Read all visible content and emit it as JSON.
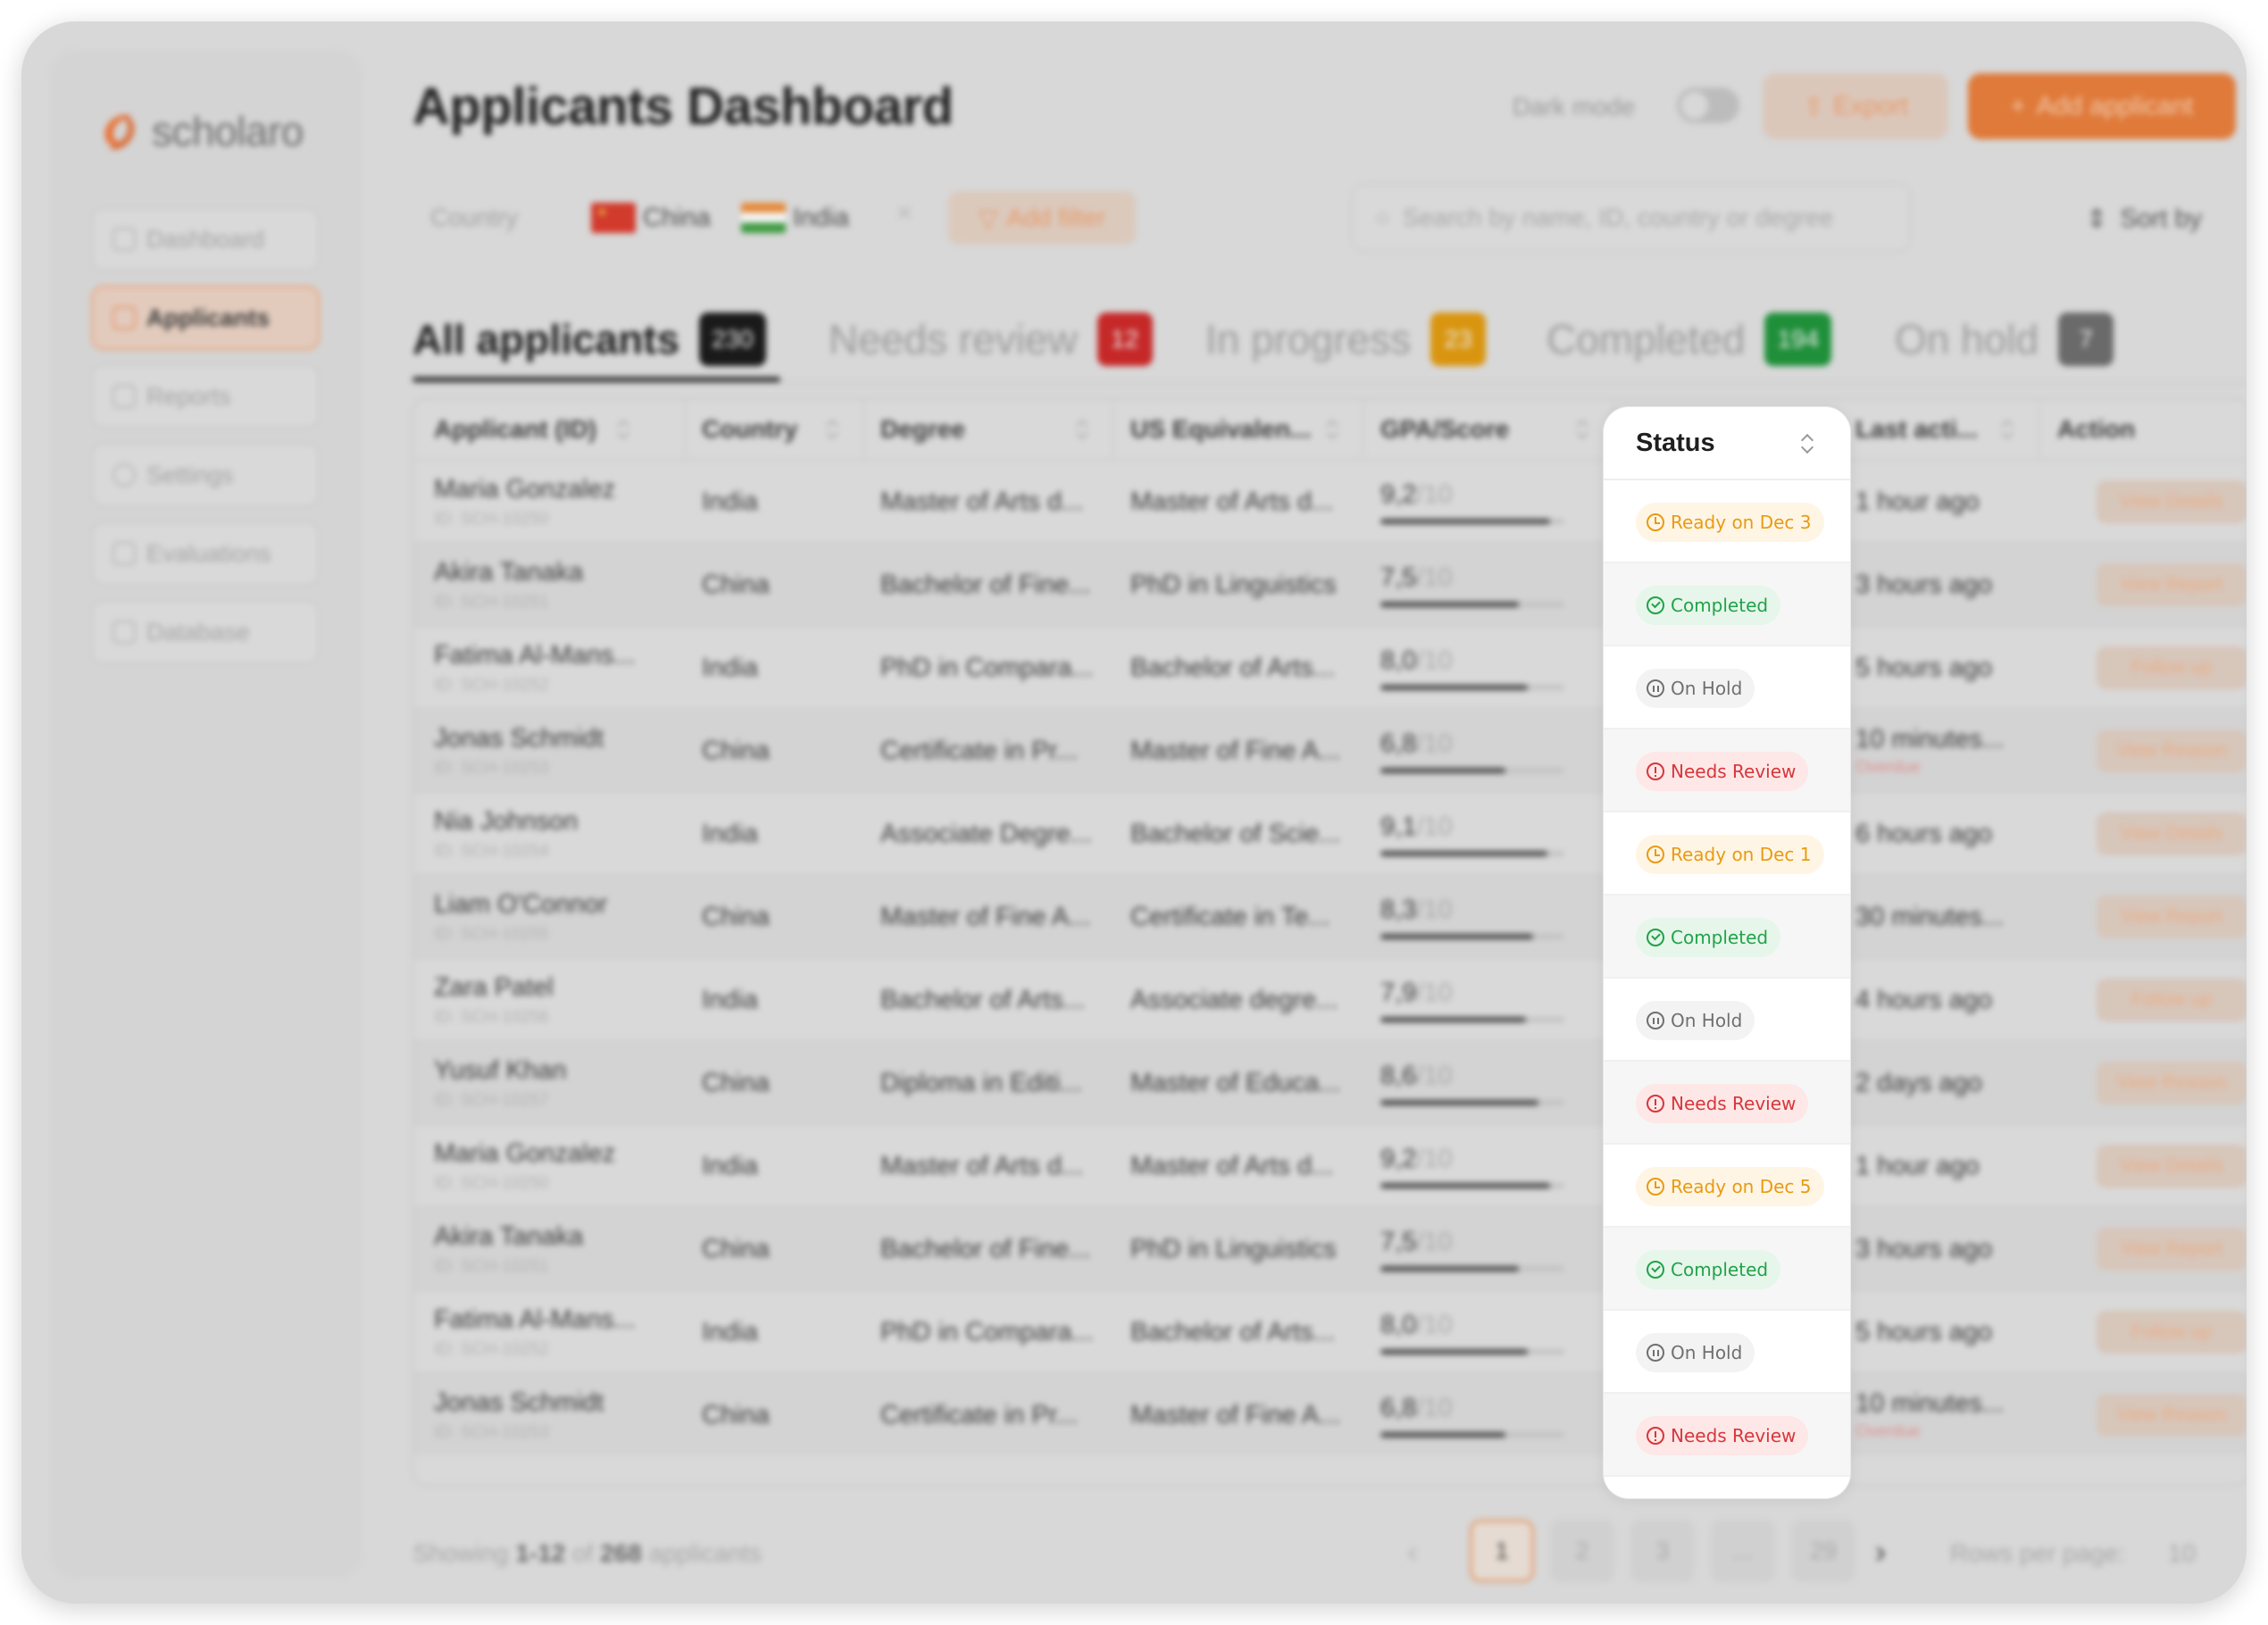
{
  "brand": {
    "name": "scholaro"
  },
  "sidebar": {
    "items": [
      {
        "label": "Dashboard",
        "active": false
      },
      {
        "label": "Applicants",
        "active": true
      },
      {
        "label": "Reports",
        "active": false
      },
      {
        "label": "Settings",
        "active": false
      },
      {
        "label": "Evaluations",
        "active": false
      },
      {
        "label": "Database",
        "active": false
      }
    ]
  },
  "header": {
    "title": "Applicants Dashboard",
    "dark_mode_label": "Dark mode",
    "dark_mode_on": false,
    "export_label": "Export",
    "add_label": "Add applicant"
  },
  "filters": {
    "label": "Country",
    "chips": [
      {
        "label": "China"
      },
      {
        "label": "India"
      }
    ],
    "clear_label": "×",
    "add_filter_label": "Add filter",
    "search_placeholder": "Search by name, ID, country or degree",
    "sort_label": "Sort by"
  },
  "tabs": [
    {
      "label": "All applicants",
      "count": "230",
      "color": "#1a1a1a",
      "active": true
    },
    {
      "label": "Needs review",
      "count": "12",
      "color": "#c62828",
      "active": false
    },
    {
      "label": "In progress",
      "count": "23",
      "color": "#d9950f",
      "active": false
    },
    {
      "label": "Completed",
      "count": "194",
      "color": "#1f8f3a",
      "active": false
    },
    {
      "label": "On hold",
      "count": "7",
      "color": "#6a6a6a",
      "active": false
    }
  ],
  "table": {
    "columns": [
      "Applicant (ID)",
      "Country",
      "Degree",
      "US Equivalen...",
      "GPA/Score",
      "Status",
      "Last acti...",
      "Action"
    ],
    "gpa_denominator": "/10",
    "rows": [
      {
        "name": "Maria Gonzalez",
        "id": "ID: SCH-10250",
        "country": "India",
        "degree": "Master of Arts d...",
        "us_equiv": "Master of Arts d...",
        "gpa": "9,2",
        "gpa_value": 9.2,
        "status": "Ready on Dec 3",
        "status_type": "ready",
        "last": "1 hour ago",
        "overdue": "",
        "action": "View Details"
      },
      {
        "name": "Akira Tanaka",
        "id": "ID: SCH-10251",
        "country": "China",
        "degree": "Bachelor of Fine...",
        "us_equiv": "PhD in Linguistics",
        "gpa": "7,5",
        "gpa_value": 7.5,
        "status": "Completed",
        "status_type": "completed",
        "last": "3 hours ago",
        "overdue": "",
        "action": "View Report"
      },
      {
        "name": "Fatima Al-Mans...",
        "id": "ID: SCH-10252",
        "country": "India",
        "degree": "PhD in Compara...",
        "us_equiv": "Bachelor of Arts...",
        "gpa": "8,0",
        "gpa_value": 8.0,
        "status": "On Hold",
        "status_type": "onhold",
        "last": "5 hours ago",
        "overdue": "",
        "action": "Follow up"
      },
      {
        "name": "Jonas Schmidt",
        "id": "ID: SCH-10253",
        "country": "China",
        "degree": "Certificate in Pr...",
        "us_equiv": "Master of Fine A...",
        "gpa": "6,8",
        "gpa_value": 6.8,
        "status": "Needs Review",
        "status_type": "review",
        "last": "10 minutes...",
        "overdue": "Overdue",
        "action": "View Reason"
      },
      {
        "name": "Nia Johnson",
        "id": "ID: SCH-10254",
        "country": "India",
        "degree": "Associate Degre...",
        "us_equiv": "Bachelor of Scie...",
        "gpa": "9,1",
        "gpa_value": 9.1,
        "status": "Ready on Dec 1",
        "status_type": "ready",
        "last": "6 hours ago",
        "overdue": "",
        "action": "View Details"
      },
      {
        "name": "Liam O'Connor",
        "id": "ID: SCH-10255",
        "country": "China",
        "degree": "Master of Fine A...",
        "us_equiv": "Certificate in Te...",
        "gpa": "8,3",
        "gpa_value": 8.3,
        "status": "Completed",
        "status_type": "completed",
        "last": "30 minutes...",
        "overdue": "",
        "action": "View Report"
      },
      {
        "name": "Zara Patel",
        "id": "ID: SCH-10256",
        "country": "India",
        "degree": "Bachelor of Arts...",
        "us_equiv": "Associate degre...",
        "gpa": "7,9",
        "gpa_value": 7.9,
        "status": "On Hold",
        "status_type": "onhold",
        "last": "4 hours ago",
        "overdue": "",
        "action": "Follow up"
      },
      {
        "name": "Yusuf Khan",
        "id": "ID: SCH-10257",
        "country": "China",
        "degree": "Diploma in Editi...",
        "us_equiv": "Master of Educa...",
        "gpa": "8,6",
        "gpa_value": 8.6,
        "status": "Needs Review",
        "status_type": "review",
        "last": "2 days ago",
        "overdue": "",
        "action": "View Reason"
      },
      {
        "name": "Maria Gonzalez",
        "id": "ID: SCH-10250",
        "country": "India",
        "degree": "Master of Arts d...",
        "us_equiv": "Master of Arts d...",
        "gpa": "9,2",
        "gpa_value": 9.2,
        "status": "Ready on Dec 5",
        "status_type": "ready",
        "last": "1 hour ago",
        "overdue": "",
        "action": "View Details"
      },
      {
        "name": "Akira Tanaka",
        "id": "ID: SCH-10251",
        "country": "China",
        "degree": "Bachelor of Fine...",
        "us_equiv": "PhD in Linguistics",
        "gpa": "7,5",
        "gpa_value": 7.5,
        "status": "Completed",
        "status_type": "completed",
        "last": "3 hours ago",
        "overdue": "",
        "action": "View Report"
      },
      {
        "name": "Fatima Al-Mans...",
        "id": "ID: SCH-10252",
        "country": "India",
        "degree": "PhD in Compara...",
        "us_equiv": "Bachelor of Arts...",
        "gpa": "8,0",
        "gpa_value": 8.0,
        "status": "On Hold",
        "status_type": "onhold",
        "last": "5 hours ago",
        "overdue": "",
        "action": "Follow up"
      },
      {
        "name": "Jonas Schmidt",
        "id": "ID: SCH-10253",
        "country": "China",
        "degree": "Certificate in Pr...",
        "us_equiv": "Master of Fine A...",
        "gpa": "6,8",
        "gpa_value": 6.8,
        "status": "Needs Review",
        "status_type": "review",
        "last": "10 minutes...",
        "overdue": "Overdue",
        "action": "View Reason"
      }
    ]
  },
  "footer": {
    "showing_prefix": "Showing",
    "showing_range": "1-12",
    "showing_of": "of",
    "showing_total": "268",
    "showing_suffix": "applicants",
    "pages": [
      "1",
      "2",
      "3",
      "...",
      "29"
    ],
    "current_page": "1",
    "prev_label": "‹",
    "next_label": "›",
    "rows_label": "Rows per page:",
    "rows_value": "10"
  },
  "colors": {
    "accent": "#e8753b",
    "ready": "#e89b12",
    "completed": "#22a24a",
    "onhold": "#707070",
    "review": "#d6373b"
  }
}
